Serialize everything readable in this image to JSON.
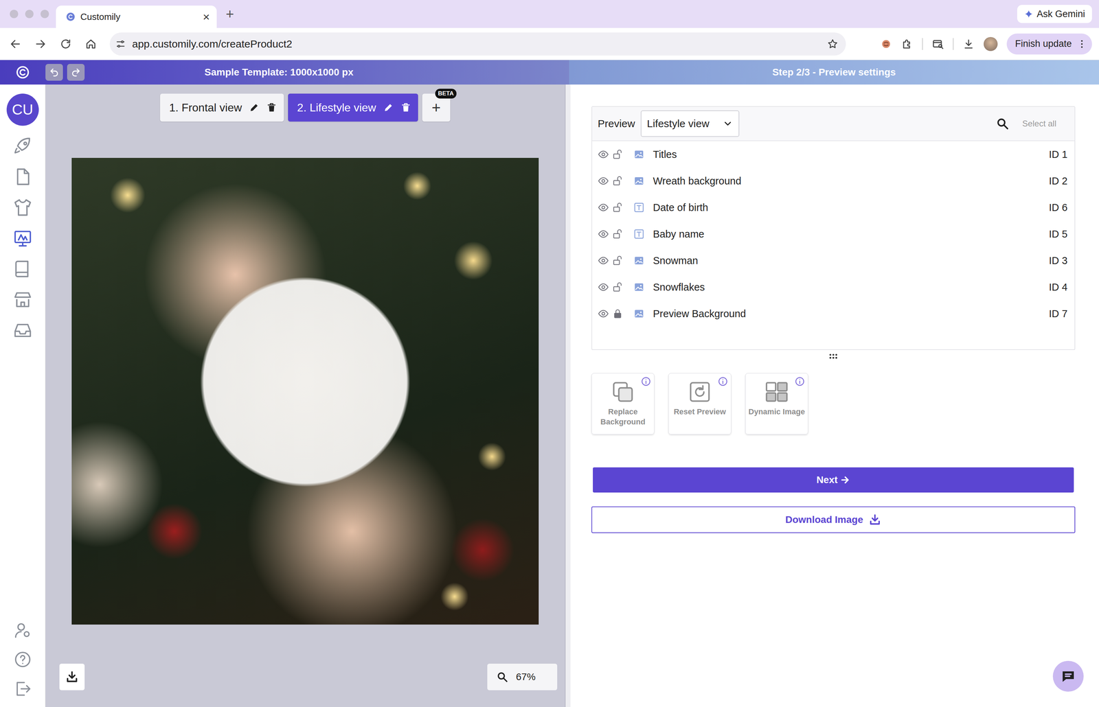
{
  "browser": {
    "tab_title": "Customily",
    "tab_close": "×",
    "new_tab": "+",
    "url": "app.customily.com/createProduct2",
    "gemini": "Ask Gemini",
    "finish": "Finish update"
  },
  "header": {
    "title": "Sample Template: 1000x1000 px",
    "step": "Step 2/3 - Preview settings"
  },
  "sidebar": {
    "avatar": "CU",
    "items": [
      {
        "selected": false
      },
      {
        "selected": false
      },
      {
        "selected": false
      },
      {
        "selected": true
      },
      {
        "selected": false
      },
      {
        "selected": false
      },
      {
        "selected": false
      }
    ],
    "bottom_items": [
      {
        "selected": false
      },
      {
        "selected": false
      },
      {
        "selected": false
      }
    ]
  },
  "views": [
    {
      "label": "1. Frontal view",
      "selected": false
    },
    {
      "label": "2. Lifestyle view",
      "selected": true
    }
  ],
  "add_view": {
    "label": "+",
    "badge": "BETA"
  },
  "zoom": "67%",
  "preview": {
    "label": "Preview",
    "view": "Lifestyle view",
    "select_all": "Select all",
    "layers": [
      {
        "name": "Titles",
        "id": "ID 1",
        "kind": "image",
        "visible": true,
        "locked": false
      },
      {
        "name": "Wreath background",
        "id": "ID 2",
        "kind": "image",
        "visible": true,
        "locked": false
      },
      {
        "name": "Date of birth",
        "id": "ID 6",
        "kind": "text",
        "visible": true,
        "locked": false
      },
      {
        "name": "Baby name",
        "id": "ID 5",
        "kind": "text",
        "visible": true,
        "locked": false
      },
      {
        "name": "Snowman",
        "id": "ID 3",
        "kind": "image",
        "visible": true,
        "locked": false
      },
      {
        "name": "Snowflakes",
        "id": "ID 4",
        "kind": "image",
        "visible": true,
        "locked": false
      },
      {
        "name": "Preview Background",
        "id": "ID 7",
        "kind": "image",
        "visible": true,
        "locked": true
      }
    ]
  },
  "tools": [
    {
      "label": "Replace Background",
      "disabled": true
    },
    {
      "label": "Reset Preview",
      "disabled": true
    },
    {
      "label": "Dynamic Image",
      "disabled": true
    }
  ],
  "next": "Next",
  "download": "Download Image"
}
